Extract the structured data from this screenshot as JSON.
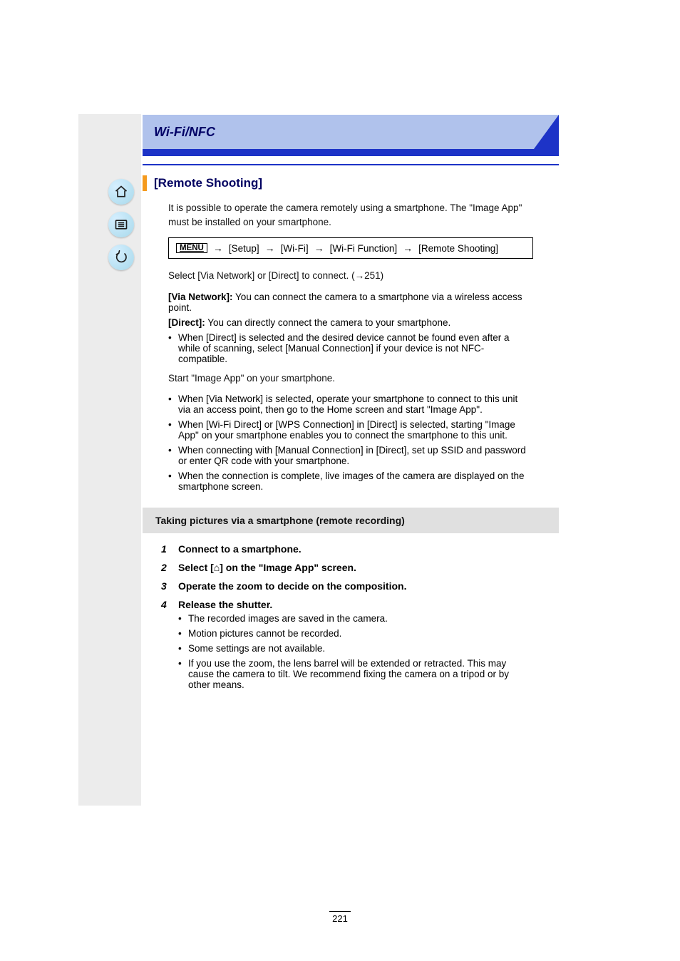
{
  "banner": {
    "title": "Wi-Fi/NFC"
  },
  "section": {
    "title": "[Remote Shooting]"
  },
  "intro": "It is possible to operate the camera remotely using a smartphone. The \"Image App\" must be installed on your smartphone.",
  "menu_path": {
    "tag": "MENU",
    "segments": [
      "[Setup]",
      "[Wi-Fi]",
      "[Wi-Fi Function]",
      "[Remote Shooting]"
    ]
  },
  "connect_line": "Select [Via Network] or [Direct] to connect.",
  "connect_ref": "(→251)",
  "direct_note": "When [Direct] is selected and the desired device cannot be found even after a while of scanning, select [Manual Connection] if your device is not NFC-compatible.",
  "launch_line": "Start \"Image App\" on your smartphone.",
  "launch_bullets": [
    "When [Via Network] is selected, operate your smartphone to connect to this unit via an access point, then go to the Home screen and start \"Image App\".",
    "When [Wi-Fi Direct] or [WPS Connection] in [Direct] is selected, starting \"Image App\" on your smartphone enables you to connect the smartphone to this unit.",
    "When connecting with [Manual Connection] in [Direct], set up SSID and password or enter QR code with your smartphone.",
    "When the connection is complete, live images of the camera are displayed on the smartphone screen."
  ],
  "options": [
    {
      "label": "[Via Network]:",
      "text": "You can connect the camera to a smartphone via a wireless access point."
    },
    {
      "label": "[Direct]:",
      "text": "You can directly connect the camera to your smartphone."
    }
  ],
  "callout": "Taking pictures via a smartphone (remote recording)",
  "steps": [
    {
      "num": "1",
      "body": "Connect to a smartphone.",
      "sub": null
    },
    {
      "num": "2",
      "body": "Select [⌂] on the \"Image App\" screen.",
      "sub": null
    },
    {
      "num": "3",
      "body": "Operate the zoom to decide on the composition.",
      "sub": null
    },
    {
      "num": "4",
      "body": "Release the shutter.",
      "sub_bullets": [
        "The recorded images are saved in the camera.",
        "Motion pictures cannot be recorded.",
        "Some settings are not available.",
        "If you use the zoom, the lens barrel will be extended or retracted. This may cause the camera to tilt. We recommend fixing the camera on a tripod or by other means."
      ]
    }
  ],
  "page_number": "221"
}
